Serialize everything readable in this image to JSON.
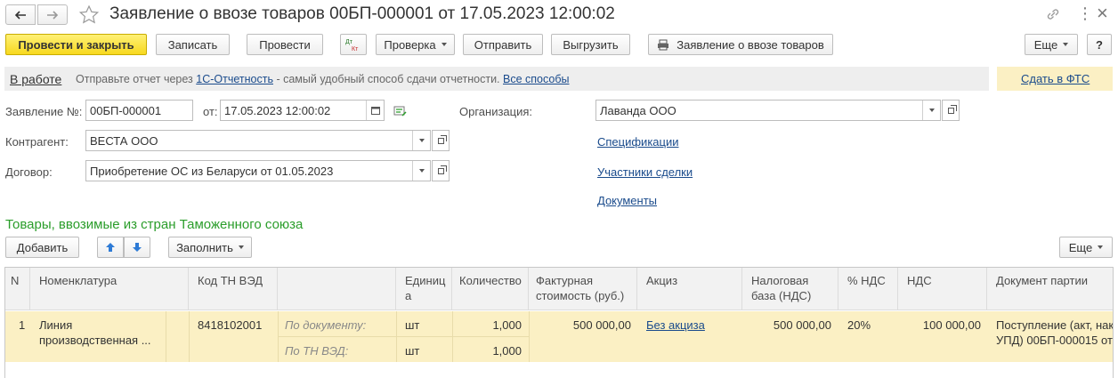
{
  "window": {
    "title": "Заявление о ввозе товаров 00БП-000001 от 17.05.2023 12:00:02",
    "more_icon": "⋮",
    "close_icon": "×"
  },
  "toolbar": {
    "post_close": "Провести и закрыть",
    "save": "Записать",
    "post": "Провести",
    "dt_kt": "Дт Кт",
    "check": "Проверка",
    "send": "Отправить",
    "export": "Выгрузить",
    "print": "Заявление о ввозе товаров",
    "more": "Еще",
    "help": "?"
  },
  "status_bar": {
    "status": "В работе",
    "msg_prefix": "Отправьте отчет через",
    "msg_link": "1С-Отчетность",
    "msg_suffix": "- самый удобный способ сдачи отчетности.",
    "all_ways": "Все способы",
    "submit": "Сдать в ФТС"
  },
  "form": {
    "number_label": "Заявление №:",
    "number_value": "00БП-000001",
    "date_label": "от:",
    "date_value": "17.05.2023 12:00:02",
    "org_label": "Организация:",
    "org_value": "Лаванда ООО",
    "counterparty_label": "Контрагент:",
    "counterparty_value": "ВЕСТА ООО",
    "contract_label": "Договор:",
    "contract_value": "Приобретение ОС из Беларуси от 01.05.2023",
    "links": {
      "specs": "Спецификации",
      "participants": "Участники сделки",
      "documents": "Документы"
    }
  },
  "goods": {
    "section_title": "Товары, ввозимые из стран Таможенного союза",
    "add": "Добавить",
    "fill": "Заполнить",
    "more": "Еще",
    "columns": [
      "N",
      "Номенклатура",
      "Код ТН ВЭД",
      "",
      "Единица",
      "Количество",
      "Фактурная стоимость (руб.)",
      "Акциз",
      "Налоговая база (НДС)",
      "% НДС",
      "НДС",
      "Документ партии"
    ],
    "row": {
      "n": "1",
      "nomenclature_line1": "Линия",
      "nomenclature_line2": "производственная ...",
      "tn_ved": "8418102001",
      "by_doc_label": "По документу:",
      "by_tnved_label": "По ТН ВЭД:",
      "unit1": "шт",
      "unit2": "шт",
      "qty1": "1,000",
      "qty2": "1,000",
      "invoice": "500 000,00",
      "excise": "Без акциза",
      "tax_base": "500 000,00",
      "vat_rate": "20%",
      "vat": "100 000,00",
      "batch_line1": "Поступление (акт, накл",
      "batch_line2": "УПД) 00БП-000015 от"
    }
  },
  "colors": {
    "primary_yellow": "#f7d81f",
    "selected_row": "#fbf0c4",
    "green_title": "#2a9d2a",
    "link_blue": "#1a4b8c"
  }
}
